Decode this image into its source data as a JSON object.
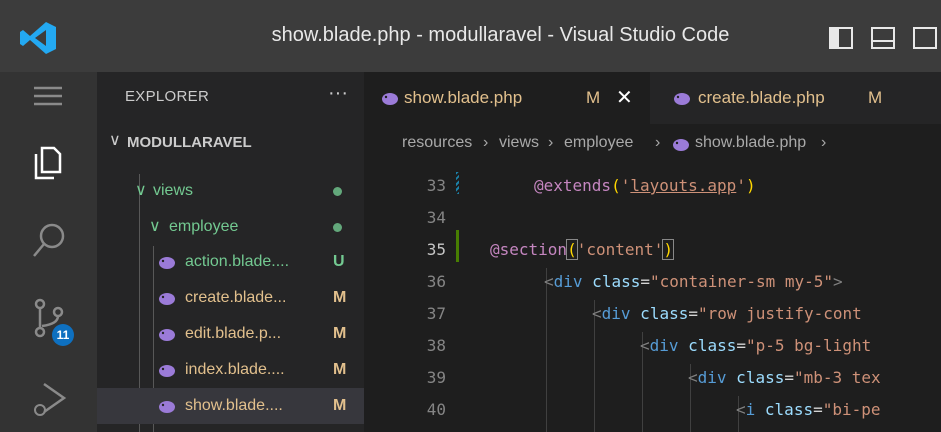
{
  "window": {
    "title": "show.blade.php - modullaravel - Visual Studio Code"
  },
  "activity_bar": {
    "items": [
      {
        "icon": "menu-icon"
      },
      {
        "icon": "explorer-files-icon"
      },
      {
        "icon": "search-icon"
      },
      {
        "icon": "source-control-icon",
        "badge": "11"
      },
      {
        "icon": "run-debug-icon"
      }
    ]
  },
  "sidebar": {
    "title": "EXPLORER",
    "more": "···",
    "workspace": "MODULLARAVEL",
    "folders": [
      {
        "name": "views"
      },
      {
        "name": "employee"
      }
    ],
    "files": [
      {
        "name": "action.blade....",
        "status": "U",
        "status_color": "#73c991"
      },
      {
        "name": "create.blade...",
        "status": "M",
        "status_color": "#e2c08d"
      },
      {
        "name": "edit.blade.p...",
        "status": "M",
        "status_color": "#e2c08d"
      },
      {
        "name": "index.blade....",
        "status": "M",
        "status_color": "#e2c08d"
      },
      {
        "name": "show.blade....",
        "status": "M",
        "status_color": "#e2c08d"
      }
    ]
  },
  "tabs": [
    {
      "label": "show.blade.php",
      "status": "M",
      "close": "✕"
    },
    {
      "label": "create.blade.php",
      "status": "M"
    }
  ],
  "breadcrumb": [
    "resources",
    "views",
    "employee",
    "show.blade.php"
  ],
  "breadcrumb_sep": "›",
  "editor": {
    "line_numbers": [
      "33",
      "34",
      "35",
      "36",
      "37",
      "38",
      "39",
      "40"
    ],
    "lines": {
      "l33": {
        "a": "@extends",
        "b": "(",
        "c": "'",
        "d": "layouts.app",
        "e": "'",
        "f": ")"
      },
      "l35": {
        "a": "@section",
        "b": "(",
        "c": "'content'",
        "d": ")"
      },
      "l36": {
        "a": "<",
        "b": "div",
        "c": " class",
        "d": "=",
        "e": "\"container-sm my-5\"",
        "f": ">"
      },
      "l37": {
        "a": "<",
        "b": "div",
        "c": " class",
        "d": "=",
        "e": "\"row justify-cont"
      },
      "l38": {
        "a": "<",
        "b": "div",
        "c": " class",
        "d": "=",
        "e": "\"p-5 bg-light"
      },
      "l39": {
        "a": "<",
        "b": "div",
        "c": " class",
        "d": "=",
        "e": "\"mb-3 tex"
      },
      "l40": {
        "a": "<",
        "b": "i",
        "c": " class",
        "d": "=",
        "e": "\"bi-pe"
      }
    }
  },
  "colors": {
    "accent": "#0e70c0",
    "modified": "#e2c08d",
    "untracked": "#73c991"
  }
}
